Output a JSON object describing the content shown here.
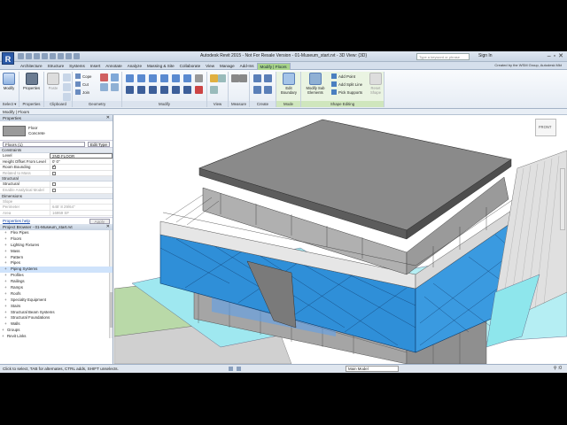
{
  "app": {
    "title": "Autodesk Revit 2015 -  Not For Resale Version  -   01-Museum_start.rvt - 3D View: {3D}",
    "search_placeholder": "Type a keyword or phrase",
    "sign_in": "Sign In",
    "credit": "Created by the WSM Group, Autodesk Mkt"
  },
  "tabs": [
    "Architecture",
    "Structure",
    "Systems",
    "Insert",
    "Annotate",
    "Analyze",
    "Massing & Site",
    "Collaborate",
    "View",
    "Manage",
    "Add-Ins",
    "Modify | Floors"
  ],
  "ribbon": {
    "modify": "Modify",
    "properties": "Properties",
    "paste": "Paste",
    "cope": "Cope",
    "cut": "Cut",
    "join": "Join",
    "edit_boundary": "Edit Boundary",
    "modify_sub_elements": "Modify Sub Elements",
    "add_point": "Add Point",
    "add_split_line": "Add Split Line",
    "pick_supports": "Pick Supports",
    "reset_shape": "Reset Shape",
    "panels": {
      "select": "Select ▾",
      "properties": "Properties",
      "clipboard": "Clipboard",
      "geometry": "Geometry",
      "modify": "Modify",
      "view": "View",
      "measure": "Measure",
      "create": "Create",
      "mode": "Mode",
      "shape_editing": "Shape Editing"
    }
  },
  "modebar": "Modify | Floors",
  "properties": {
    "header": "Properties",
    "type_family": "Floor",
    "type_name": "Concrete",
    "instance": "Floors (1)",
    "edit_type": "Edit Type",
    "categories": {
      "constraints": "Constraints",
      "structural": "Structural",
      "dimensions": "Dimensions"
    },
    "rows_constraints": [
      {
        "k": "Level",
        "v": "2ND FLOOR"
      },
      {
        "k": "Height Offset From Level",
        "v": "0'  0\""
      },
      {
        "k": "Room Bounding",
        "v": ""
      },
      {
        "k": "Related to Mass",
        "v": ""
      }
    ],
    "rows_structural": [
      {
        "k": "Structural",
        "v": ""
      },
      {
        "k": "Enable Analytical Model",
        "v": ""
      }
    ],
    "rows_dimensions": [
      {
        "k": "Slope",
        "v": ""
      },
      {
        "k": "Perimeter",
        "v": "645' 8 29/64\""
      },
      {
        "k": "Area",
        "v": "16959 SF"
      }
    ],
    "help": "Properties help",
    "apply": "Apply"
  },
  "browser": {
    "header": "Project Browser - 01-Museum_start.rvt",
    "items": [
      "Flex Pipes",
      "Floors",
      "Lighting Fixtures",
      "Mass",
      "Pattern",
      "Pipes",
      "Piping Systems",
      "Profiles",
      "Railings",
      "Ramps",
      "Roofs",
      "Specialty Equipment",
      "Stairs",
      "Structural Beam Systems",
      "Structural Foundations",
      "Walls"
    ],
    "top_items": [
      "Groups",
      "Revit Links"
    ],
    "selected": "Piping Systems"
  },
  "viewport": {
    "viewcube": "FRONT",
    "scale": "1/8\" = 1'-0\""
  },
  "status": {
    "text": "Click to select, TAB for alternates, CTRL adds, SHIFT unselects.",
    "model": "Main Model",
    "zero": ":0"
  },
  "colors": {
    "ribbon_context": "#a8d48a",
    "glass_blue": "#2f8fd8",
    "floor_cyan": "#9fe8f0",
    "selection": "#cfe3fb"
  }
}
